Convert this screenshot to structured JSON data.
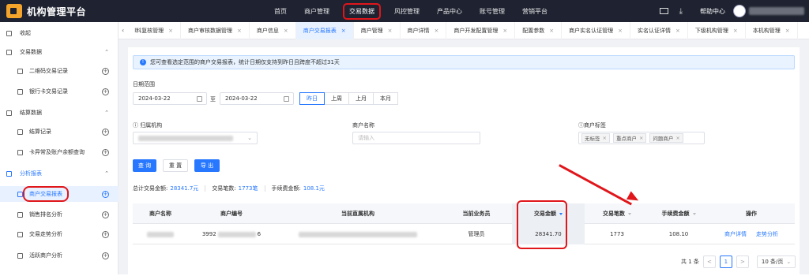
{
  "app": {
    "title": "机构管理平台"
  },
  "topnav": {
    "items": [
      "首页",
      "商户管理",
      "交易数据",
      "风控管理",
      "产品中心",
      "账号管理",
      "营销平台"
    ],
    "help": "帮助中心"
  },
  "sidebar": {
    "collapse": "收起",
    "items": [
      {
        "label": "交易数据"
      },
      {
        "label": "二维码交易记录"
      },
      {
        "label": "银行卡交易记录"
      },
      {
        "label": "结算数据"
      },
      {
        "label": "结算记录"
      },
      {
        "label": "卡异常及账户余额查询"
      },
      {
        "label": "分析报表"
      },
      {
        "label": "商户交易报表"
      },
      {
        "label": "销售排名分析"
      },
      {
        "label": "交易走势分析"
      },
      {
        "label": "活跃商户分析"
      }
    ]
  },
  "tabs": [
    "l料复核管理",
    "商户审核数据管理",
    "商户信息",
    "商户交易报表",
    "商户管理",
    "商户详情",
    "商户开发配置管理",
    "配置参数",
    "商户实名认证管理",
    "实名认证详情",
    "下级机构管理",
    "本机构管理"
  ],
  "tab_close": "×",
  "alert": {
    "icon": "!",
    "text": "您可查看选定范围的商户交易报表，统计日期仅支持到昨日且跨度不超过31天"
  },
  "filters": {
    "date_label": "日期范围",
    "date_from": "2024-03-22",
    "date_sep": "至",
    "date_to": "2024-03-22",
    "quick": [
      "昨日",
      "上周",
      "上月",
      "本月"
    ],
    "org_label": "归属机构",
    "merchant_label": "商户名称",
    "merchant_placeholder": "请输入",
    "tag_label": "商户标签",
    "tags": [
      "无标签",
      "重点商户",
      "问题商户"
    ]
  },
  "buttons": {
    "query": "查 询",
    "reset": "重 置",
    "export": "导 出"
  },
  "stats": {
    "total_amount_label": "总计交易金额:",
    "total_amount": "28341.7元",
    "count_label": "交易笔数:",
    "count": "1773笔",
    "fee_label": "手续费金额:",
    "fee": "108.1元"
  },
  "table": {
    "headers": [
      "商户名称",
      "商户编号",
      "当前直属机构",
      "当前业务员",
      "交易金额",
      "交易笔数",
      "手续费金额",
      "操作"
    ],
    "rows": [
      {
        "merchant_no_a": "3992",
        "merchant_no_b": "6",
        "salesperson": "管理员",
        "amount": "28341.70",
        "count": "1773",
        "fee": "108.10",
        "action_detail": "商户详情",
        "action_trend": "走势分析"
      }
    ]
  },
  "pager": {
    "total": "共 1 条",
    "prev": "<",
    "page": "1",
    "next": ">",
    "size": "10 条/页"
  },
  "colors": {
    "accent": "#2878ff",
    "highlight": "#e0161b",
    "topbar": "#1f2331"
  }
}
